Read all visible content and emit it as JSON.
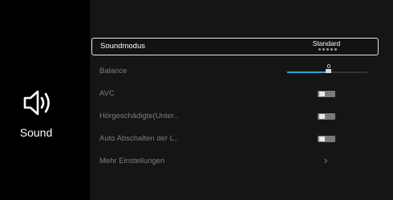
{
  "sidebar": {
    "icon": "speaker-icon",
    "title": "Sound"
  },
  "menu": {
    "items": [
      {
        "label": "Soundmodus",
        "value": "Standard",
        "mode_dots_total": 5,
        "mode_dots_active": 1
      },
      {
        "label": "Balance",
        "value": "0",
        "level": 0.5
      },
      {
        "label": "AVC",
        "toggle": "off"
      },
      {
        "label": "Hörgeschädigte(Unter..",
        "toggle": "off"
      },
      {
        "label": "Auto Abschalten der L..",
        "toggle": "off"
      },
      {
        "label": "Mehr Einstellungen",
        "icon": "chevron-right-icon"
      }
    ]
  },
  "colors": {
    "accent": "#2aa7d2",
    "panel": "#151515",
    "background": "#000000"
  }
}
